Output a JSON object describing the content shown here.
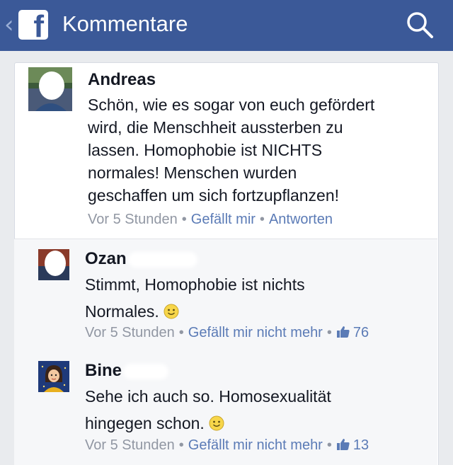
{
  "header": {
    "back_glyph": "‹",
    "logo_letter": "f",
    "title": "Kommentare",
    "search_icon": "search-icon"
  },
  "comments": [
    {
      "author": "Andreas",
      "text_lines": [
        "Schön, wie es sogar von euch gefördert",
        "wird, die Menschheit aussterben zu",
        "lassen. Homophobie ist NICHTS",
        "normales! Menschen wurden",
        "geschaffen um sich fortzupflanzen!"
      ],
      "time": "Vor 5 Stunden",
      "like_label": "Gefällt mir",
      "reply_label": "Antworten"
    }
  ],
  "replies": [
    {
      "author": "Ozan",
      "text_lines": [
        "Stimmt, Homophobie ist nichts",
        "Normales."
      ],
      "time": "Vor 5 Stunden",
      "like_label": "Gefällt mir nicht mehr",
      "like_count": "76"
    },
    {
      "author": "Bine",
      "text_lines": [
        "Sehe ich auch so. Homosexualität",
        "hingegen schon."
      ],
      "time": "Vor 5 Stunden",
      "like_label": "Gefällt mir nicht mehr",
      "like_count": "13"
    }
  ],
  "separator": "•",
  "colors": {
    "header": "#3b5998",
    "link": "#5b7bb6",
    "meta": "#9197a3"
  }
}
